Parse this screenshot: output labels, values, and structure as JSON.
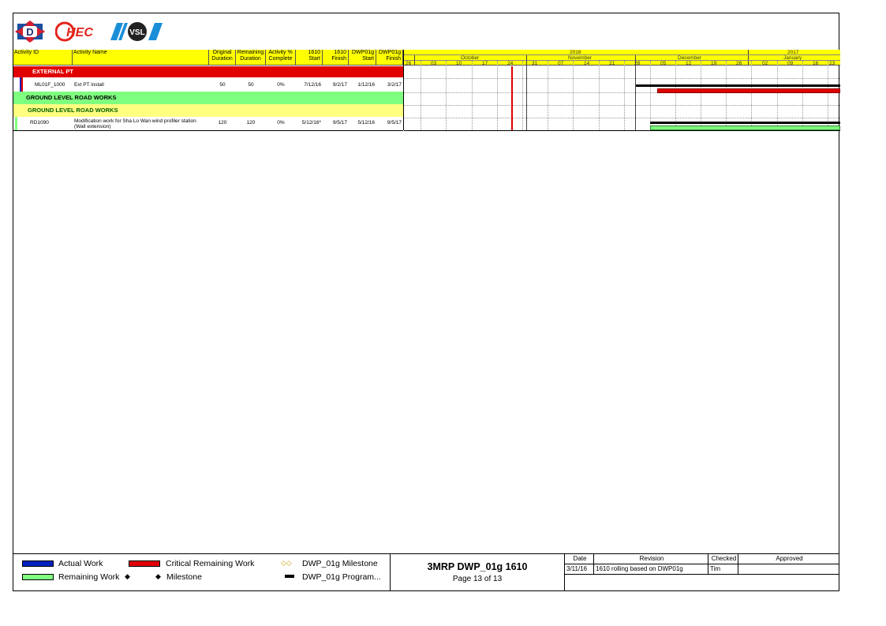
{
  "colors": {
    "header_yellow": "#ffff00",
    "critical": "#e00000",
    "remaining": "#80ff80",
    "actual": "#0020c0",
    "band_green": "#7fff7f"
  },
  "table": {
    "headers": [
      {
        "l1": "Activity ID",
        "l2": ""
      },
      {
        "l1": "Activity Name",
        "l2": ""
      },
      {
        "l1": "Original",
        "l2": "Duration"
      },
      {
        "l1": "Remaining",
        "l2": "Duration"
      },
      {
        "l1": "Activity %",
        "l2": "Complete"
      },
      {
        "l1": "1610",
        "l2": "Start"
      },
      {
        "l1": "1610",
        "l2": "Finish"
      },
      {
        "l1": "DWP01g",
        "l2": "Start"
      },
      {
        "l1": "DWP01g",
        "l2": "Finish"
      }
    ],
    "bands": {
      "external": "EXTERNAL PT",
      "glrw1": "GROUND LEVEL ROAD WORKS",
      "glrw2": "GROUND LEVEL ROAD WORKS"
    },
    "rows": [
      {
        "id": "ML01F_1000",
        "name": "Ext PT install",
        "od": "50",
        "rd": "50",
        "pct": "0%",
        "s1": "7/12/16",
        "f1": "9/2/17",
        "s2": "1/12/16",
        "f2": "3/2/17"
      },
      {
        "id": "RD1090",
        "name": "Modification work for Sha Lo Wan wind profiler station (Wall extension)",
        "od": "120",
        "rd": "120",
        "pct": "0%",
        "s1": "5/12/16*",
        "f1": "9/5/17",
        "s2": "5/12/16",
        "f2": "9/5/17"
      }
    ]
  },
  "gantt": {
    "years": [
      "2016",
      "2017"
    ],
    "months": [
      "October",
      "November",
      "December",
      "January"
    ],
    "weeks": [
      "26",
      "03",
      "10",
      "17",
      "24",
      "31",
      "07",
      "14",
      "21",
      "28",
      "05",
      "12",
      "19",
      "26",
      "02",
      "09",
      "16",
      "23"
    ]
  },
  "legend": {
    "actual": "Actual Work",
    "critical": "Critical Remaining Work",
    "remaining": "Remaining Work",
    "remaining_sym": "◆",
    "dwp_milestone_sym": "◇◇",
    "dwp_milestone": "DWP_01g Milestone",
    "milestone_sym": "◆",
    "milestone": "Milestone",
    "dwp_program": "DWP_01g Program..."
  },
  "title_block": {
    "title": "3MRP DWP_01g 1610",
    "page": "Page 13 of 13"
  },
  "revision": {
    "headers": [
      "Date",
      "Revision",
      "Checked",
      "Approved"
    ],
    "row": [
      "3/11/16",
      "1610 rolling based on DWP01g",
      "Tim",
      ""
    ]
  }
}
